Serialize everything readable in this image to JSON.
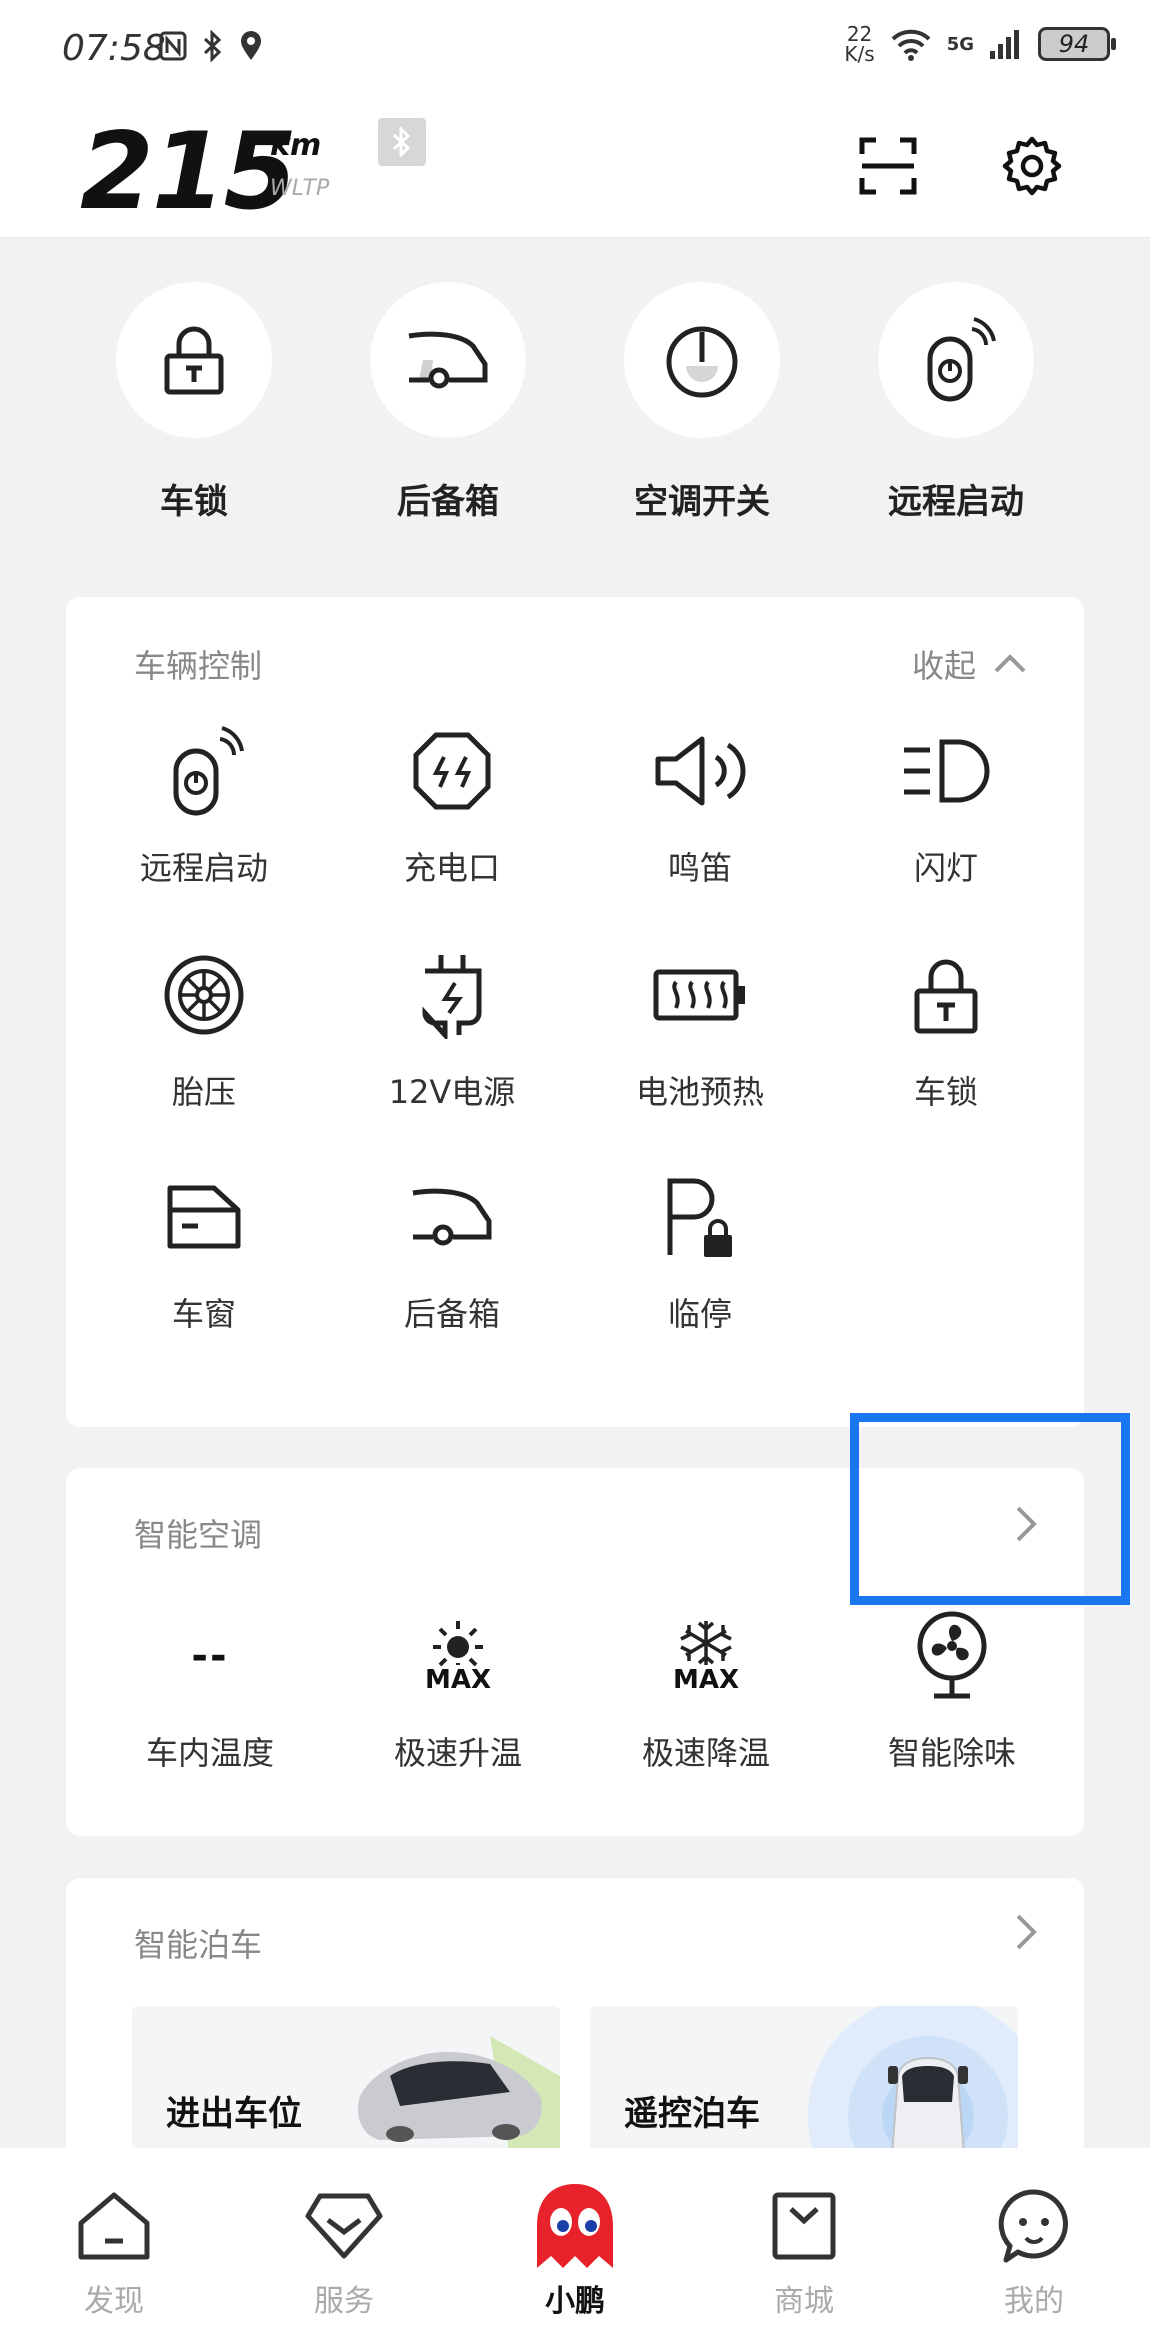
{
  "status_bar": {
    "time": "07:58",
    "speed_value": "22",
    "speed_unit": "K/s",
    "network": "5G",
    "battery": "94"
  },
  "header": {
    "range_value": "215",
    "range_unit": "km",
    "range_standard": "WLTP"
  },
  "quick_actions": [
    {
      "label": "车锁",
      "icon": "lock-icon"
    },
    {
      "label": "后备箱",
      "icon": "trunk-icon"
    },
    {
      "label": "空调开关",
      "icon": "power-icon"
    },
    {
      "label": "远程启动",
      "icon": "remote-start-icon"
    }
  ],
  "vehicle_control": {
    "title": "车辆控制",
    "collapse_label": "收起",
    "items": [
      {
        "label": "远程启动",
        "icon": "remote-start-icon"
      },
      {
        "label": "充电口",
        "icon": "charge-port-icon"
      },
      {
        "label": "鸣笛",
        "icon": "horn-icon"
      },
      {
        "label": "闪灯",
        "icon": "headlight-icon"
      },
      {
        "label": "胎压",
        "icon": "tire-icon"
      },
      {
        "label": "12V电源",
        "icon": "plug-icon"
      },
      {
        "label": "电池预热",
        "icon": "battery-heat-icon"
      },
      {
        "label": "车锁",
        "icon": "lock-icon"
      },
      {
        "label": "车窗",
        "icon": "window-icon"
      },
      {
        "label": "后备箱",
        "icon": "trunk-icon"
      },
      {
        "label": "临停",
        "icon": "parking-lock-icon"
      }
    ]
  },
  "smart_ac": {
    "title": "智能空调",
    "cabin_temp_value": "--",
    "items": [
      {
        "label": "车内温度"
      },
      {
        "label": "极速升温",
        "badge": "MAX"
      },
      {
        "label": "极速降温",
        "badge": "MAX"
      },
      {
        "label": "智能除味"
      }
    ]
  },
  "smart_parking": {
    "title": "智能泊车",
    "tiles": [
      {
        "label": "进出车位"
      },
      {
        "label": "遥控泊车"
      }
    ]
  },
  "bottom_nav": [
    {
      "label": "发现",
      "icon": "home-icon"
    },
    {
      "label": "服务",
      "icon": "service-icon"
    },
    {
      "label": "小鹏",
      "icon": "mascot-icon"
    },
    {
      "label": "商城",
      "icon": "shop-icon"
    },
    {
      "label": "我的",
      "icon": "profile-icon"
    }
  ],
  "colors": {
    "highlight": "#1976f0",
    "mascot": "#e8222b",
    "background": "#f2f2f2"
  }
}
